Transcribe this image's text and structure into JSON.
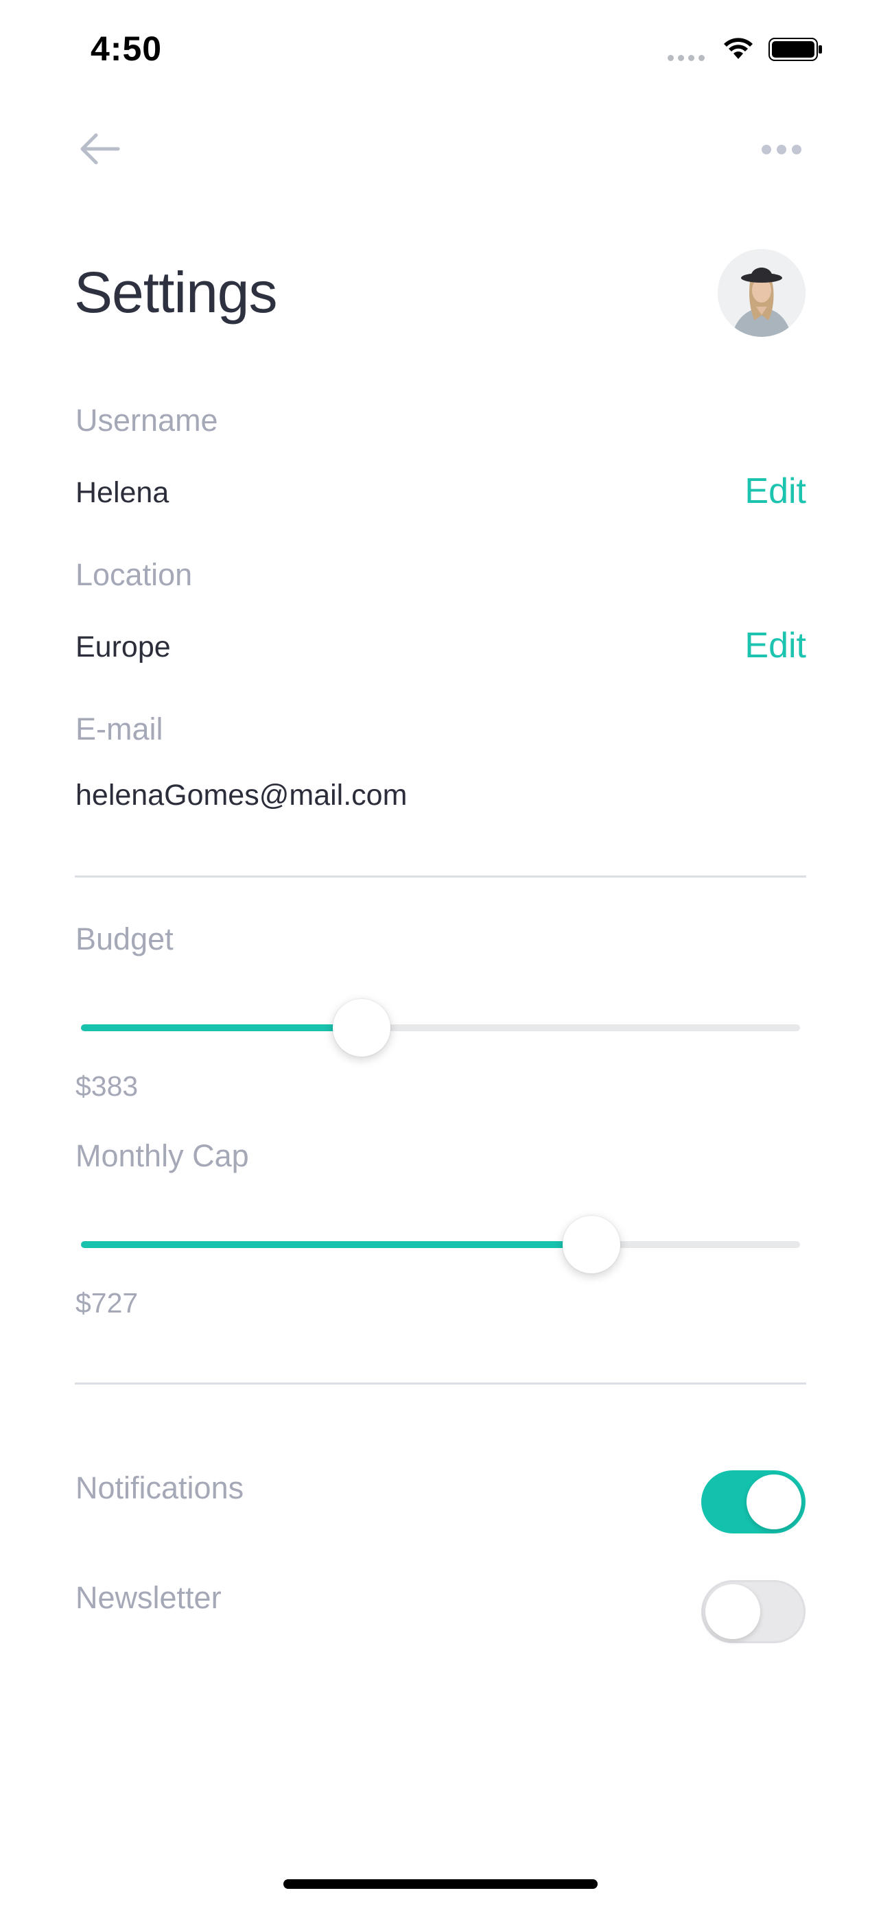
{
  "status_bar": {
    "time": "4:50"
  },
  "header": {
    "title": "Settings"
  },
  "profile": {
    "username_label": "Username",
    "username_value": "Helena",
    "location_label": "Location",
    "location_value": "Europe",
    "email_label": "E-mail",
    "email_value": "helenaGomes@mail.com",
    "edit_label": "Edit"
  },
  "sliders": {
    "budget": {
      "label": "Budget",
      "value_text": "$383",
      "fraction": 0.39
    },
    "monthly_cap": {
      "label": "Monthly Cap",
      "value_text": "$727",
      "fraction": 0.71
    }
  },
  "toggles": {
    "notifications": {
      "label": "Notifications",
      "on": true
    },
    "newsletter": {
      "label": "Newsletter",
      "on": false
    }
  },
  "colors": {
    "accent": "#19c2ad",
    "label": "#a4a8b7",
    "text": "#2b2e3a"
  }
}
